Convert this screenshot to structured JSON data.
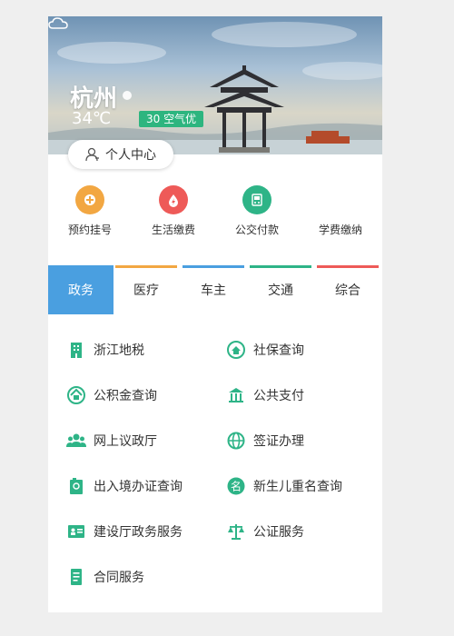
{
  "header": {
    "city": "杭州",
    "temperature": "34℃",
    "air_quality": "30 空气优",
    "profile_button": "个人中心"
  },
  "quick_actions": [
    {
      "label": "预约挂号",
      "icon": "clinic-icon",
      "color": "#f2a742"
    },
    {
      "label": "生活缴费",
      "icon": "utility-drop-icon",
      "color": "#ee5a58"
    },
    {
      "label": "公交付款",
      "icon": "bus-card-icon",
      "color": "#2eb487"
    },
    {
      "label": "学费缴纳",
      "icon": "tuition-icon",
      "color": "#ffffff"
    }
  ],
  "tabs": [
    {
      "label": "政务",
      "active": true,
      "bar_color": "#4a9fe0"
    },
    {
      "label": "医疗",
      "active": false,
      "bar_color": "#f2a742"
    },
    {
      "label": "车主",
      "active": false,
      "bar_color": "#4a9fe0"
    },
    {
      "label": "交通",
      "active": false,
      "bar_color": "#2eb487"
    },
    {
      "label": "综合",
      "active": false,
      "bar_color": "#ee5a58"
    }
  ],
  "services": [
    {
      "label": "浙江地税",
      "icon": "building-icon"
    },
    {
      "label": "社保查询",
      "icon": "home-shield-icon"
    },
    {
      "label": "公积金查询",
      "icon": "house-fund-icon"
    },
    {
      "label": "公共支付",
      "icon": "bank-icon"
    },
    {
      "label": "网上议政厅",
      "icon": "people-icon"
    },
    {
      "label": "签证办理",
      "icon": "globe-icon"
    },
    {
      "label": "出入境办证查询",
      "icon": "passport-icon"
    },
    {
      "label": "新生儿重名查询",
      "icon": "name-badge-icon"
    },
    {
      "label": "建设厅政务服务",
      "icon": "id-card-icon"
    },
    {
      "label": "公证服务",
      "icon": "scales-icon"
    },
    {
      "label": "合同服务",
      "icon": "document-icon"
    }
  ],
  "accent_green": "#2eb487"
}
